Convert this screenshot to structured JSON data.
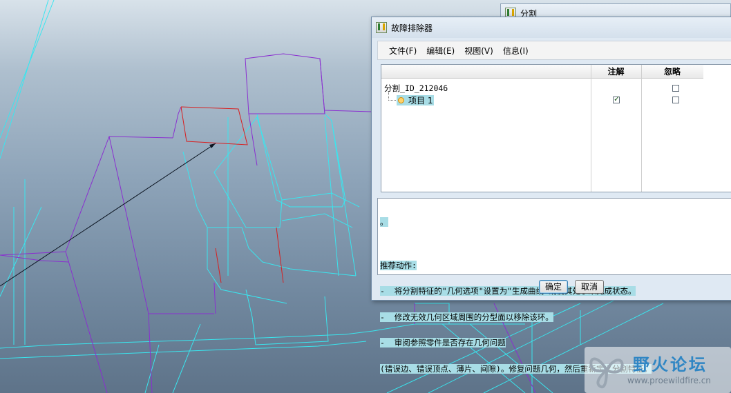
{
  "background_window": {
    "title": "分割"
  },
  "dialog": {
    "title": "故障排除器",
    "menu": [
      "文件(F)",
      "编辑(E)",
      "视图(V)",
      "信息(I)"
    ],
    "columns": {
      "annotate": "注解",
      "ignore": "忽略"
    },
    "tree": {
      "root_label": "分割_ID_212046",
      "root_ignore_checked": false,
      "child_label": "项目 1",
      "child_annotate_checked": true,
      "child_ignore_checked": false
    },
    "message_lines": [
      "。",
      "",
      "推荐动作:",
      "-  将分割特征的\"几何选项\"设置为\"生成曲线\"或使其处于未完成状态。",
      "-  修改无效几何区域周围的分型面以移除该环。",
      "-  审阅参照零件是否存在几何问题",
      "(错误边、错误顶点、薄片、间隙)。修复问题几何，然后重新定义分割特征。"
    ],
    "buttons": {
      "ok": "确定",
      "cancel": "取消"
    }
  },
  "watermark": {
    "title": "野火论坛",
    "url": "www.proewildfire.cn"
  },
  "colors": {
    "wire_cyan": "#39e6ef",
    "wire_purple": "#8a2fd0",
    "wire_red": "#d81f1f",
    "highlight": "#a8dde6"
  }
}
